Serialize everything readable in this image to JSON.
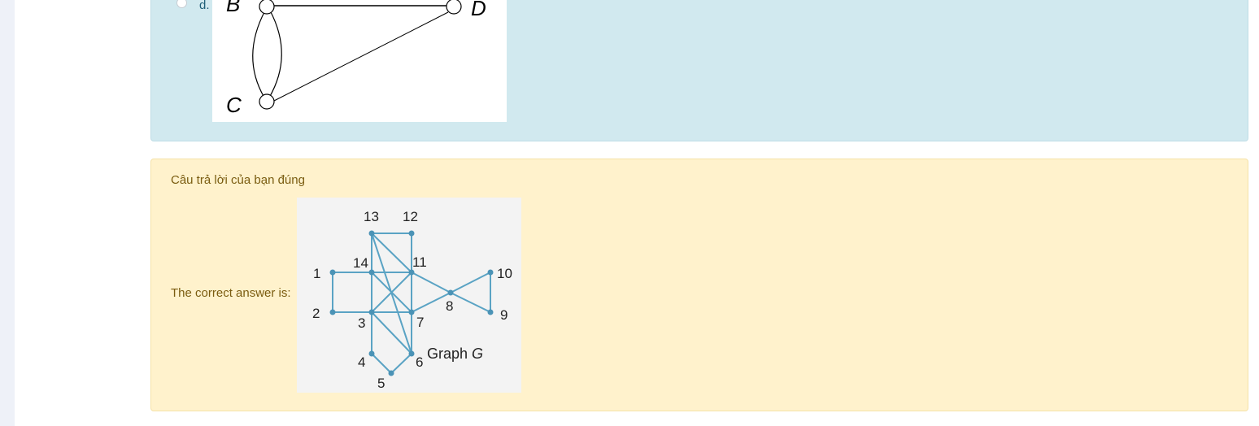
{
  "option": {
    "letter": "d.",
    "graph_labels": {
      "b": "B",
      "c": "C",
      "d": "D"
    }
  },
  "feedback": {
    "result_text": "Câu trả lời của bạn đúng",
    "correct_label": "The correct answer is:"
  },
  "graph_g": {
    "caption_prefix": "Graph ",
    "caption_name": "G",
    "vertex_labels": {
      "v1": "1",
      "v2": "2",
      "v3": "3",
      "v4": "4",
      "v5": "5",
      "v6": "6",
      "v7": "7",
      "v8": "8",
      "v9": "9",
      "v10": "10",
      "v11": "11",
      "v12": "12",
      "v13": "13",
      "v14": "14"
    }
  },
  "colors": {
    "answer_panel": "#d1e9ef",
    "feedback_panel": "#fff2cc",
    "graph_edges": "#5aa3c4"
  }
}
